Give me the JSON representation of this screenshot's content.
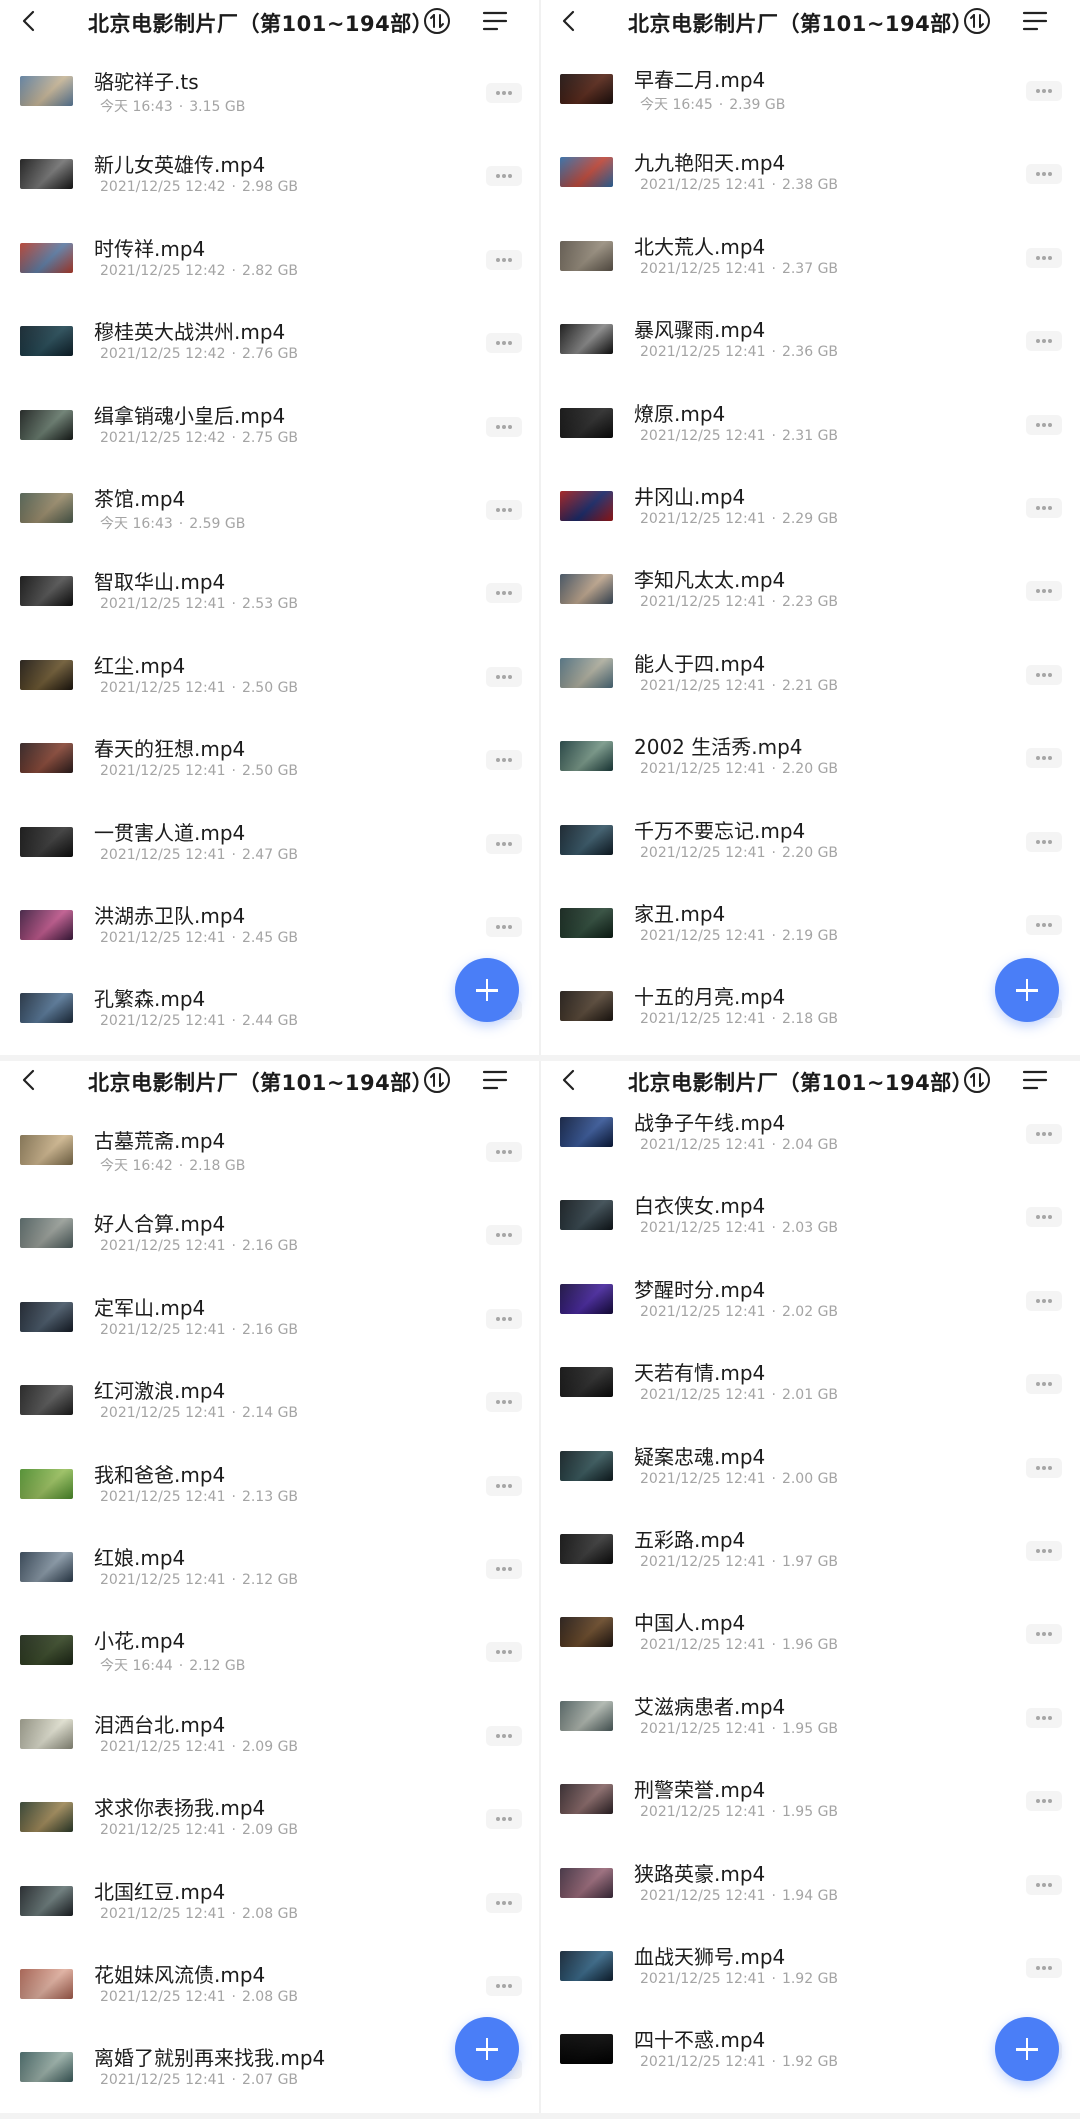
{
  "panels": [
    {
      "header": {
        "title": "北京电影制片厂（第101~194部）"
      },
      "items": [
        {
          "name": "骆驼祥子.ts",
          "date": "今天 16:43",
          "size": "3.15 GB",
          "thumb": [
            "#5a7b9c",
            "#c9b89a"
          ]
        },
        {
          "name": "新儿女英雄传.mp4",
          "date": "2021/12/25 12:42",
          "size": "2.98 GB",
          "thumb": [
            "#141414",
            "#777777"
          ]
        },
        {
          "name": "时传祥.mp4",
          "date": "2021/12/25 12:42",
          "size": "2.82 GB",
          "thumb": [
            "#b33c2c",
            "#5f7ea6"
          ]
        },
        {
          "name": "穆桂英大战洪州.mp4",
          "date": "2021/12/25 12:42",
          "size": "2.76 GB",
          "thumb": [
            "#0d1e28",
            "#264a56"
          ]
        },
        {
          "name": "缉拿销魂小皇后.mp4",
          "date": "2021/12/25 12:42",
          "size": "2.75 GB",
          "thumb": [
            "#161a18",
            "#6a7d70"
          ]
        },
        {
          "name": "茶馆.mp4",
          "date": "今天 16:43",
          "size": "2.59 GB",
          "thumb": [
            "#4a5a4c",
            "#9c8e6e"
          ]
        },
        {
          "name": "智取华山.mp4",
          "date": "2021/12/25 12:41",
          "size": "2.53 GB",
          "thumb": [
            "#0c0c0c",
            "#555555"
          ]
        },
        {
          "name": "红尘.mp4",
          "date": "2021/12/25 12:41",
          "size": "2.50 GB",
          "thumb": [
            "#1a140e",
            "#6e5a34"
          ]
        },
        {
          "name": "春天的狂想.mp4",
          "date": "2021/12/25 12:41",
          "size": "2.50 GB",
          "thumb": [
            "#2a1c1c",
            "#8a4a3a"
          ]
        },
        {
          "name": "一贯害人道.mp4",
          "date": "2021/12/25 12:41",
          "size": "2.47 GB",
          "thumb": [
            "#0d0d0d",
            "#3a3a3a"
          ]
        },
        {
          "name": "洪湖赤卫队.mp4",
          "date": "2021/12/25 12:41",
          "size": "2.45 GB",
          "thumb": [
            "#3a1a3c",
            "#c05a8e"
          ]
        },
        {
          "name": "孔繁森.mp4",
          "date": "2021/12/25 12:41",
          "size": "2.44 GB",
          "thumb": [
            "#1c2a3a",
            "#5a7a9a"
          ]
        }
      ]
    },
    {
      "header": {
        "title": "北京电影制片厂（第101~194部）"
      },
      "items": [
        {
          "name": "早春二月.mp4",
          "date": "今天 16:45",
          "size": "2.39 GB",
          "thumb": [
            "#1a0e0c",
            "#5a2a1c"
          ]
        },
        {
          "name": "九九艳阳天.mp4",
          "date": "2021/12/25 12:41",
          "size": "2.38 GB",
          "thumb": [
            "#2e6aa4",
            "#c04a3c"
          ]
        },
        {
          "name": "北大荒人.mp4",
          "date": "2021/12/25 12:41",
          "size": "2.37 GB",
          "thumb": [
            "#5a5248",
            "#9a9080"
          ]
        },
        {
          "name": "暴风骤雨.mp4",
          "date": "2021/12/25 12:41",
          "size": "2.36 GB",
          "thumb": [
            "#0e0e0e",
            "#8a8a8a"
          ]
        },
        {
          "name": "燎原.mp4",
          "date": "2021/12/25 12:41",
          "size": "2.31 GB",
          "thumb": [
            "#0a0a0a",
            "#2a2a2a"
          ]
        },
        {
          "name": "井冈山.mp4",
          "date": "2021/12/25 12:41",
          "size": "2.29 GB",
          "thumb": [
            "#a01818",
            "#1a2a6a"
          ]
        },
        {
          "name": "李知凡太太.mp4",
          "date": "2021/12/25 12:41",
          "size": "2.23 GB",
          "thumb": [
            "#3a4a5a",
            "#c0a890"
          ]
        },
        {
          "name": "能人于四.mp4",
          "date": "2021/12/25 12:41",
          "size": "2.21 GB",
          "thumb": [
            "#4a6a7a",
            "#b0b0a0"
          ]
        },
        {
          "name": "2002 生活秀.mp4",
          "date": "2021/12/25 12:41",
          "size": "2.20 GB",
          "thumb": [
            "#1a3a3a",
            "#7a9a8a"
          ]
        },
        {
          "name": "千万不要忘记.mp4",
          "date": "2021/12/25 12:41",
          "size": "2.20 GB",
          "thumb": [
            "#0e1a24",
            "#3a5a6a"
          ]
        },
        {
          "name": "家丑.mp4",
          "date": "2021/12/25 12:41",
          "size": "2.19 GB",
          "thumb": [
            "#0c1c14",
            "#2e4a3a"
          ]
        },
        {
          "name": "十五的月亮.mp4",
          "date": "2021/12/25 12:41",
          "size": "2.18 GB",
          "thumb": [
            "#1a1410",
            "#5a4a3a"
          ]
        }
      ]
    },
    {
      "header": {
        "title": "北京电影制片厂（第101~194部）"
      },
      "items": [
        {
          "name": "古墓荒斋.mp4",
          "date": "今天 16:42",
          "size": "2.18 GB",
          "thumb": [
            "#7a6a4a",
            "#d0b890"
          ]
        },
        {
          "name": "好人合算.mp4",
          "date": "2021/12/25 12:41",
          "size": "2.16 GB",
          "thumb": [
            "#4a5a5a",
            "#9aa09a"
          ]
        },
        {
          "name": "定军山.mp4",
          "date": "2021/12/25 12:41",
          "size": "2.16 GB",
          "thumb": [
            "#141a24",
            "#4a5a6a"
          ]
        },
        {
          "name": "红河激浪.mp4",
          "date": "2021/12/25 12:41",
          "size": "2.14 GB",
          "thumb": [
            "#1a1a1a",
            "#5a5a5a"
          ]
        },
        {
          "name": "我和爸爸.mp4",
          "date": "2021/12/25 12:41",
          "size": "2.13 GB",
          "thumb": [
            "#4a8a2a",
            "#9ac060"
          ]
        },
        {
          "name": "红娘.mp4",
          "date": "2021/12/25 12:41",
          "size": "2.12 GB",
          "thumb": [
            "#2a3a4a",
            "#8a9aa8"
          ]
        },
        {
          "name": "小花.mp4",
          "date": "今天 16:44",
          "size": "2.12 GB",
          "thumb": [
            "#1a2414",
            "#3a4a2a"
          ]
        },
        {
          "name": "泪洒台北.mp4",
          "date": "2021/12/25 12:41",
          "size": "2.09 GB",
          "thumb": [
            "#8a8a7a",
            "#e0e0d0"
          ]
        },
        {
          "name": "求求你表扬我.mp4",
          "date": "2021/12/25 12:41",
          "size": "2.09 GB",
          "thumb": [
            "#2a3a2a",
            "#a08a5a"
          ]
        },
        {
          "name": "北国红豆.mp4",
          "date": "2021/12/25 12:41",
          "size": "2.08 GB",
          "thumb": [
            "#1a1e22",
            "#6a7a7a"
          ]
        },
        {
          "name": "花姐妹风流债.mp4",
          "date": "2021/12/25 12:41",
          "size": "2.08 GB",
          "thumb": [
            "#a05a4a",
            "#e0b0a0"
          ]
        },
        {
          "name": "离婚了就别再来找我.mp4",
          "date": "2021/12/25 12:41",
          "size": "2.07 GB",
          "thumb": [
            "#3a5a5a",
            "#9ab0a8"
          ]
        }
      ]
    },
    {
      "header": {
        "title": "北京电影制片厂（第101~194部）"
      },
      "items": [
        {
          "name": "战争子午线.mp4",
          "date": "2021/12/25 12:41",
          "size": "2.04 GB",
          "thumb": [
            "#0a1838",
            "#3a5a9a"
          ]
        },
        {
          "name": "白衣侠女.mp4",
          "date": "2021/12/25 12:41",
          "size": "2.03 GB",
          "thumb": [
            "#0e1418",
            "#3a4a52"
          ]
        },
        {
          "name": "梦醒时分.mp4",
          "date": "2021/12/25 12:41",
          "size": "2.02 GB",
          "thumb": [
            "#140a3a",
            "#4a2aa0"
          ]
        },
        {
          "name": "天若有情.mp4",
          "date": "2021/12/25 12:41",
          "size": "2.01 GB",
          "thumb": [
            "#0a0a0a",
            "#2a2a2a"
          ]
        },
        {
          "name": "疑案忠魂.mp4",
          "date": "2021/12/25 12:41",
          "size": "2.00 GB",
          "thumb": [
            "#0e1a1e",
            "#3a5a5e"
          ]
        },
        {
          "name": "五彩路.mp4",
          "date": "2021/12/25 12:41",
          "size": "1.97 GB",
          "thumb": [
            "#0a0a0a",
            "#3a3a3a"
          ]
        },
        {
          "name": "中国人.mp4",
          "date": "2021/12/25 12:41",
          "size": "1.96 GB",
          "thumb": [
            "#1e1410",
            "#6a4a2a"
          ]
        },
        {
          "name": "艾滋病患者.mp4",
          "date": "2021/12/25 12:41",
          "size": "1.95 GB",
          "thumb": [
            "#4a5a5a",
            "#b0b8b0"
          ]
        },
        {
          "name": "刑警荣誉.mp4",
          "date": "2021/12/25 12:41",
          "size": "1.95 GB",
          "thumb": [
            "#2a2024",
            "#8a6a6a"
          ]
        },
        {
          "name": "狭路英豪.mp4",
          "date": "2021/12/25 12:41",
          "size": "1.94 GB",
          "thumb": [
            "#3a2a3a",
            "#9a6a7a"
          ]
        },
        {
          "name": "血战天狮号.mp4",
          "date": "2021/12/25 12:41",
          "size": "1.92 GB",
          "thumb": [
            "#0e1e2e",
            "#3a6a8a"
          ]
        },
        {
          "name": "四十不惑.mp4",
          "date": "2021/12/25 12:41",
          "size": "1.92 GB",
          "thumb": [
            "#000000",
            "#050505"
          ]
        }
      ]
    }
  ],
  "icons": {
    "back": "back-arrow-icon",
    "sort": "sort-icon",
    "menu": "list-menu-icon",
    "more": "more-dots-icon",
    "add": "plus-icon"
  },
  "colors": {
    "accent": "#4a7ef7",
    "title": "#1b1b1b",
    "meta": "#a4a4a4"
  }
}
